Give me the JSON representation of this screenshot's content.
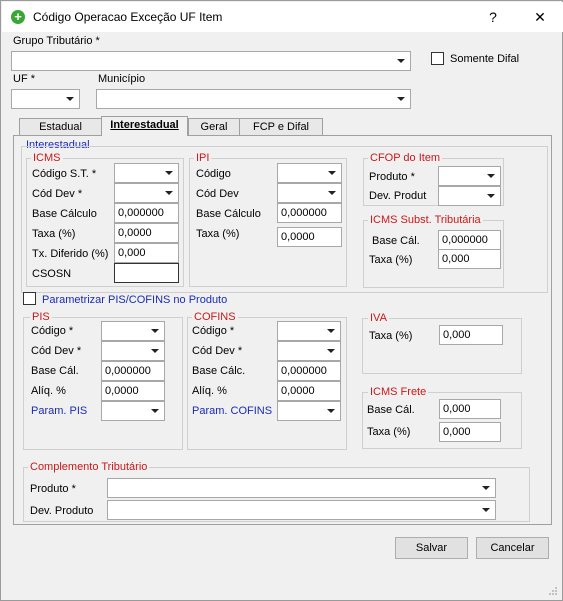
{
  "window": {
    "title": "Código Operacao Exceção UF Item",
    "help_label": "?",
    "close_label": "✕"
  },
  "header": {
    "grupo_label": "Grupo Tributário *",
    "somente_difal_label": "Somente Difal",
    "uf_label": "UF *",
    "municipio_label": "Município"
  },
  "tabs": [
    {
      "label": "Estadual"
    },
    {
      "label": "Interestadual"
    },
    {
      "label": "Geral"
    },
    {
      "label": "FCP e Difal"
    }
  ],
  "panel": {
    "section_title": "Interestadual",
    "icms": {
      "title": "ICMS",
      "codigo_st_label": "Código S.T. *",
      "cod_dev_label": "Cód Dev *",
      "base_calculo_label": "Base Cálculo",
      "base_calculo_value": "0,000000",
      "taxa_label": "Taxa (%)",
      "taxa_value": "0,0000",
      "tx_diferido_label": "Tx. Diferido (%)",
      "tx_diferido_value": "0,000",
      "csosn_label": "CSOSN"
    },
    "ipi": {
      "title": "IPI",
      "codigo_label": "Código",
      "cod_dev_label": "Cód Dev",
      "base_calculo_label": "Base Cálculo",
      "base_calculo_value": "0,000000",
      "taxa_label": "Taxa (%)",
      "taxa_value": "0,0000"
    },
    "cfop": {
      "title": "CFOP do Item",
      "produto_label": "Produto *",
      "dev_produt_label": "Dev. Produt"
    },
    "icms_st": {
      "title": "ICMS Subst. Tributária",
      "base_cal_label": "Base Cál.",
      "base_cal_value": "0,000000",
      "taxa_label": "Taxa (%)",
      "taxa_value": "0,000"
    },
    "parametrizar_label": "Parametrizar PIS/COFINS no Produto",
    "pis": {
      "title": "PIS",
      "codigo_label": "Código *",
      "cod_dev_label": "Cód Dev *",
      "base_cal_label": "Base Cál.",
      "base_cal_value": "0,000000",
      "aliq_label": "Alíq. %",
      "aliq_value": "0,0000",
      "param_label": "Param. PIS"
    },
    "cofins": {
      "title": "COFINS",
      "codigo_label": "Código *",
      "cod_dev_label": "Cód Dev *",
      "base_cal_label": "Base Cálc.",
      "base_cal_value": "0,000000",
      "aliq_label": "Alíq. %",
      "aliq_value": "0,0000",
      "param_label": "Param. COFINS"
    },
    "iva": {
      "title": "IVA",
      "taxa_label": "Taxa (%)",
      "taxa_value": "0,000"
    },
    "icms_frete": {
      "title": "ICMS Frete",
      "base_cal_label": "Base Cál.",
      "base_cal_value": "0,000",
      "taxa_label": "Taxa (%)",
      "taxa_value": "0,000"
    },
    "complemento": {
      "title": "Complemento Tributário",
      "produto_label": "Produto *",
      "dev_produto_label": "Dev. Produto"
    }
  },
  "footer": {
    "salvar_label": "Salvar",
    "cancelar_label": "Cancelar"
  },
  "colors": {
    "section_red": "#cc1818",
    "link_blue": "#1a2bb8",
    "title_icon_green": "#3aa635"
  },
  "icons": {
    "app": "plus-circle-icon",
    "dropdown": "chevron-down-icon",
    "resize": "resize-grip-icon"
  }
}
